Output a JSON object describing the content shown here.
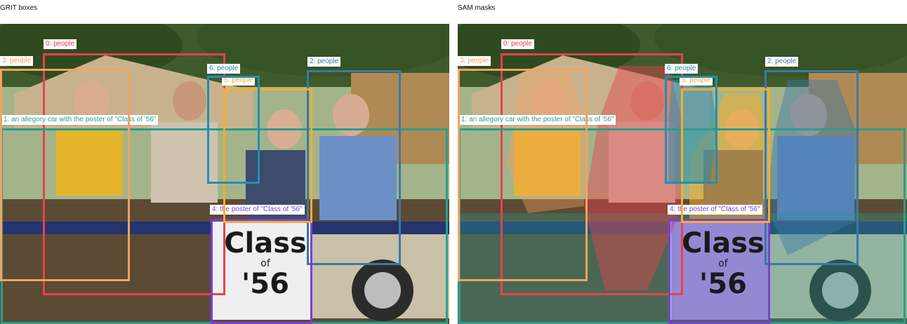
{
  "panels": {
    "left_title": "GRIT boxes",
    "right_title": "SAM masks"
  },
  "detections": [
    {
      "label": "0: people",
      "color": "#e8424e"
    },
    {
      "label": "1: an allegory car with the poster of \"Class of '56\"",
      "color": "#2a9d8f"
    },
    {
      "label": "2: people",
      "color": "#3a78a8"
    },
    {
      "label": "3: people",
      "color": "#f4a261"
    },
    {
      "label": "4: the poster of \"Class of '56\"",
      "color": "#7b3fd8"
    },
    {
      "label": "5: people",
      "color": "#f6ae2d"
    },
    {
      "label": "6: people",
      "color": "#1f8fb5"
    }
  ],
  "poster": {
    "line1": "Class",
    "line2": "of",
    "line3": "'56"
  }
}
